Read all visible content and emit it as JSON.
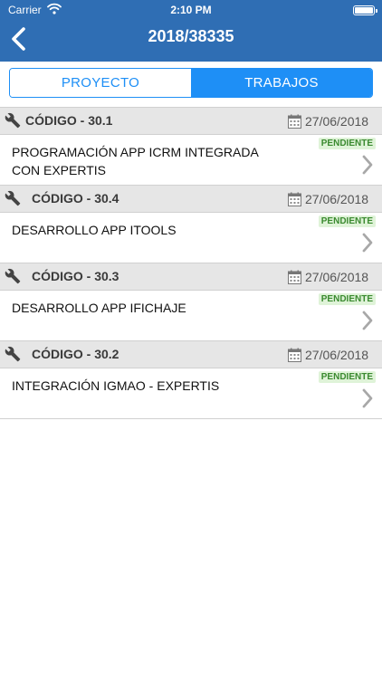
{
  "status_bar": {
    "carrier": "Carrier",
    "time": "2:10 PM"
  },
  "nav": {
    "title": "2018/38335",
    "back_icon": "chevron-left-icon"
  },
  "tabs": [
    {
      "label": "PROYECTO",
      "selected": false
    },
    {
      "label": "TRABAJOS",
      "selected": true
    }
  ],
  "colors": {
    "nav_bar": "#2f6eb4",
    "accent": "#1e8ff6",
    "badge_bg": "#dff3d8",
    "badge_text": "#3a8a2f"
  },
  "works": [
    {
      "code": "CÓDIGO - 30.1",
      "date": "27/06/2018",
      "description": "PROGRAMACIÓN APP ICRM INTEGRADA CON EXPERTIS",
      "status": "PENDIENTE"
    },
    {
      "code": "CÓDIGO - 30.4",
      "date": "27/06/2018",
      "description": "DESARROLLO APP ITOOLS",
      "status": "PENDIENTE"
    },
    {
      "code": "CÓDIGO - 30.3",
      "date": "27/06/2018",
      "description": "DESARROLLO APP IFICHAJE",
      "status": "PENDIENTE"
    },
    {
      "code": "CÓDIGO - 30.2",
      "date": "27/06/2018",
      "description": "INTEGRACIÓN IGMAO - EXPERTIS",
      "status": "PENDIENTE"
    }
  ]
}
